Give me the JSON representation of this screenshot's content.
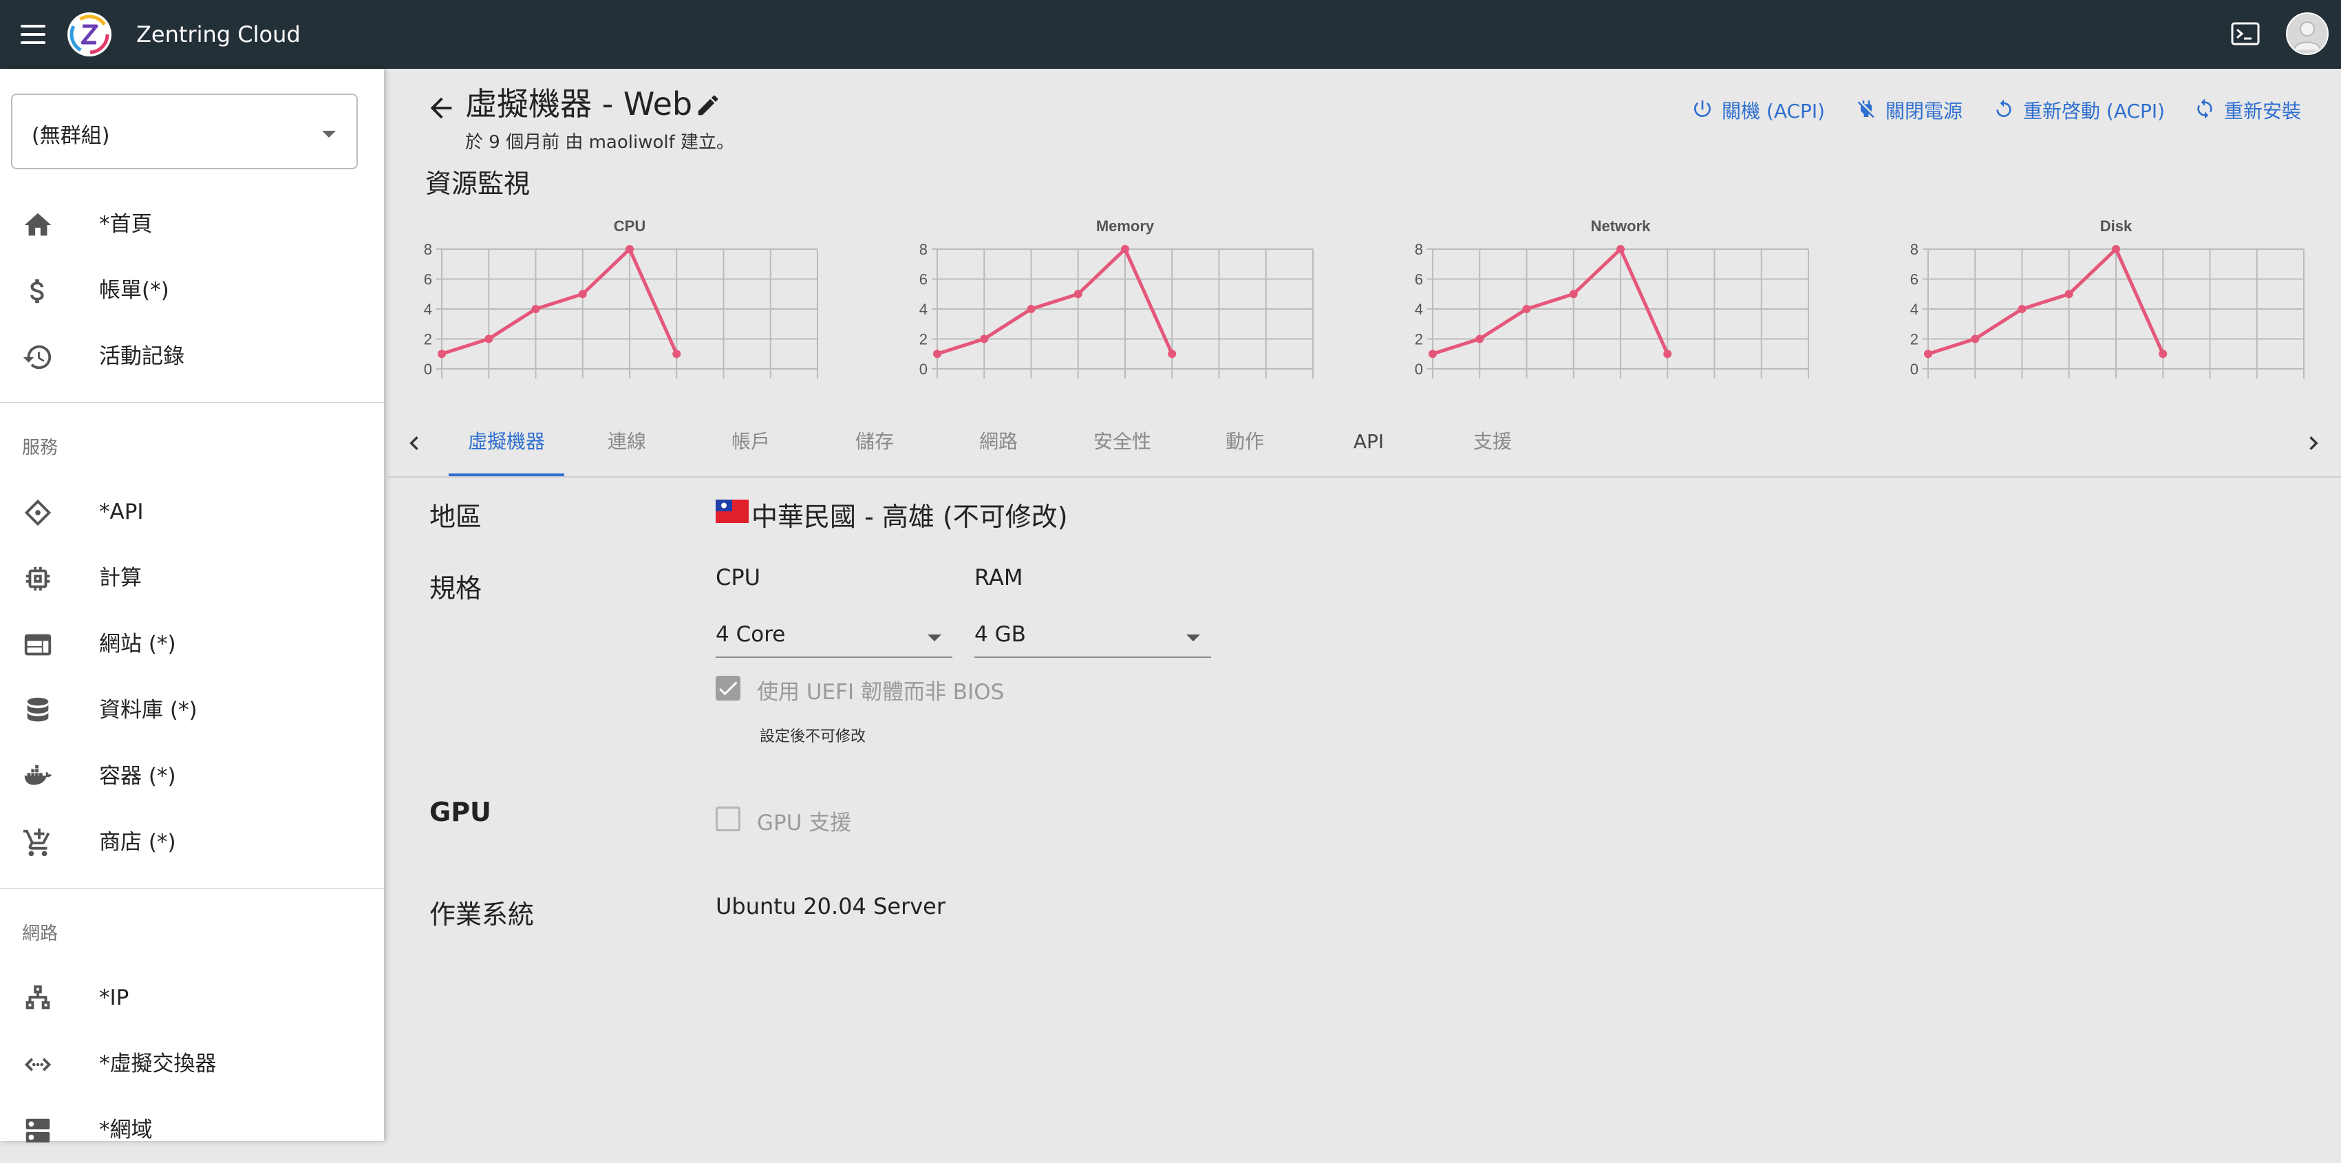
{
  "app": {
    "title": "Zentring Cloud"
  },
  "sidebar": {
    "group_select": "(無群組)",
    "items": [
      {
        "label": "*首頁",
        "icon": "home-icon"
      },
      {
        "label": "帳單(*)",
        "icon": "dollar-icon"
      },
      {
        "label": "活動記錄",
        "icon": "history-icon"
      }
    ],
    "section_services": "服務",
    "service_items": [
      {
        "label": "*API",
        "icon": "api-icon"
      },
      {
        "label": "計算",
        "icon": "cpu-chip-icon"
      },
      {
        "label": "網站 (*)",
        "icon": "web-window-icon"
      },
      {
        "label": "資料庫 (*)",
        "icon": "database-icon"
      },
      {
        "label": "容器 (*)",
        "icon": "docker-icon"
      },
      {
        "label": "商店 (*)",
        "icon": "cart-icon"
      }
    ],
    "section_network": "網路",
    "network_items": [
      {
        "label": "*IP",
        "icon": "network-tree-icon"
      },
      {
        "label": "*虛擬交換器",
        "icon": "code-arrows-icon"
      },
      {
        "label": "*網域",
        "icon": "dns-icon"
      }
    ]
  },
  "header": {
    "title": "虛擬機器 - Web",
    "subtitle": "於 9 個月前 由 maoliwolf 建立。",
    "actions": [
      {
        "label": "關機 (ACPI)",
        "icon": "power-icon"
      },
      {
        "label": "關閉電源",
        "icon": "power-off-icon"
      },
      {
        "label": "重新啓動 (ACPI)",
        "icon": "restart-icon"
      },
      {
        "label": "重新安裝",
        "icon": "reinstall-icon"
      }
    ]
  },
  "monitor": {
    "title": "資源監視"
  },
  "chart_data": [
    {
      "type": "line",
      "title": "CPU",
      "x": [
        1,
        2,
        3,
        4,
        5,
        6
      ],
      "series": [
        {
          "values": [
            1,
            2,
            4,
            5,
            8,
            1
          ]
        }
      ],
      "ylim": [
        0,
        8
      ],
      "yticks": [
        0,
        2,
        4,
        6,
        8
      ],
      "grid": true,
      "color": "#e5577a"
    },
    {
      "type": "line",
      "title": "Memory",
      "x": [
        1,
        2,
        3,
        4,
        5,
        6
      ],
      "series": [
        {
          "values": [
            1,
            2,
            4,
            5,
            8,
            1
          ]
        }
      ],
      "ylim": [
        0,
        8
      ],
      "yticks": [
        0,
        2,
        4,
        6,
        8
      ],
      "grid": true,
      "color": "#e5577a"
    },
    {
      "type": "line",
      "title": "Network",
      "x": [
        1,
        2,
        3,
        4,
        5,
        6
      ],
      "series": [
        {
          "values": [
            1,
            2,
            4,
            5,
            8,
            1
          ]
        }
      ],
      "ylim": [
        0,
        8
      ],
      "yticks": [
        0,
        2,
        4,
        6,
        8
      ],
      "grid": true,
      "color": "#e5577a"
    },
    {
      "type": "line",
      "title": "Disk",
      "x": [
        1,
        2,
        3,
        4,
        5,
        6
      ],
      "series": [
        {
          "values": [
            1,
            2,
            4,
            5,
            8,
            1
          ]
        }
      ],
      "ylim": [
        0,
        8
      ],
      "yticks": [
        0,
        2,
        4,
        6,
        8
      ],
      "grid": true,
      "color": "#e5577a"
    }
  ],
  "tabs": [
    {
      "label": "虛擬機器",
      "active": true
    },
    {
      "label": "連線"
    },
    {
      "label": "帳戶"
    },
    {
      "label": "儲存"
    },
    {
      "label": "網路"
    },
    {
      "label": "安全性"
    },
    {
      "label": "動作"
    },
    {
      "label": "API"
    },
    {
      "label": "支援"
    }
  ],
  "form": {
    "region_label": "地區",
    "region_value": "中華民國 - 高雄 (不可修改)",
    "spec_label": "規格",
    "cpu_label": "CPU",
    "cpu_value": "4 Core",
    "ram_label": "RAM",
    "ram_value": "4 GB",
    "uefi_label": "使用 UEFI 韌體而非 BIOS",
    "uefi_checked": true,
    "uefi_hint": "設定後不可修改",
    "gpu_label": "GPU",
    "gpu_support_label": "GPU 支援",
    "gpu_checked": false,
    "os_label": "作業系統",
    "os_value": "Ubuntu 20.04 Server"
  },
  "colors": {
    "topbar": "#243037",
    "accent": "#2f6fcf",
    "chart_line": "#e5577a",
    "background": "#e8e8e8"
  }
}
